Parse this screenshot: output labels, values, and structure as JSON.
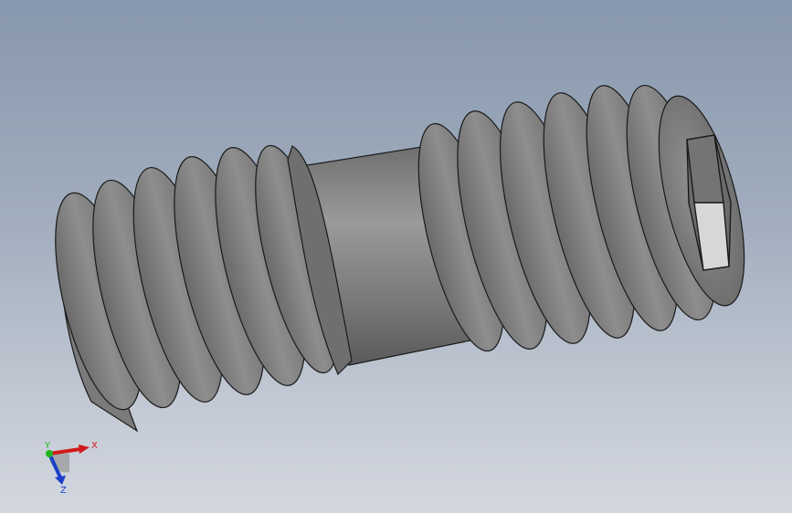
{
  "viewport": {
    "background_top": "#8797ad",
    "background_bottom": "#d3d7df"
  },
  "model": {
    "part_name": "set-screw",
    "shaded_color": "#858585",
    "edge_color": "#1a1a1a",
    "drive_type": "hex-socket-icon"
  },
  "triad": {
    "x_label": "X",
    "y_label": "Y",
    "z_label": "Z",
    "x_color": "#d11a1a",
    "y_color": "#1fb51f",
    "z_color": "#1a3fc8"
  }
}
